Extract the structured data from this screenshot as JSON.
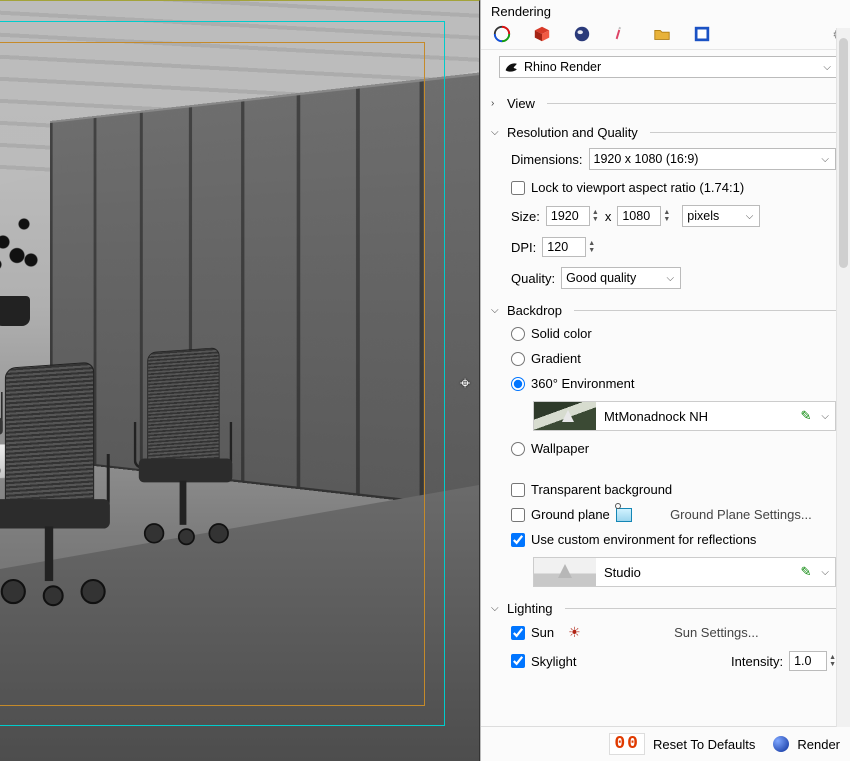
{
  "panel": {
    "title": "Rendering"
  },
  "renderer": {
    "name": "Rhino Render"
  },
  "sections": {
    "view": {
      "title": "View",
      "expanded": false
    },
    "resq": {
      "title": "Resolution and Quality",
      "dimensions_label": "Dimensions:",
      "dimensions_value": "1920 x 1080 (16:9)",
      "lock_label": "Lock to viewport aspect ratio (1.74:1)",
      "lock_checked": false,
      "size_label": "Size:",
      "size_w": "1920",
      "size_h": "1080",
      "size_sep": "x",
      "units": "pixels",
      "dpi_label": "DPI:",
      "dpi_value": "120",
      "quality_label": "Quality:",
      "quality_value": "Good quality"
    },
    "backdrop": {
      "title": "Backdrop",
      "opt_solid": "Solid color",
      "opt_gradient": "Gradient",
      "opt_360": "360° Environment",
      "env_name": "MtMonadnock NH",
      "opt_wallpaper": "Wallpaper",
      "transparent_label": "Transparent background",
      "transparent_checked": false,
      "groundplane_label": "Ground plane",
      "groundplane_checked": false,
      "groundplane_settings": "Ground Plane Settings...",
      "customenv_label": "Use custom environment for reflections",
      "customenv_checked": true,
      "studio_name": "Studio",
      "selected": "360"
    },
    "lighting": {
      "title": "Lighting",
      "sun_label": "Sun",
      "sun_checked": true,
      "sun_settings": "Sun Settings...",
      "skylight_label": "Skylight",
      "skylight_checked": true,
      "intensity_label": "Intensity:",
      "intensity_value": "1.0"
    }
  },
  "footer": {
    "digits": "00",
    "reset": "Reset To Defaults",
    "render": "Render"
  }
}
